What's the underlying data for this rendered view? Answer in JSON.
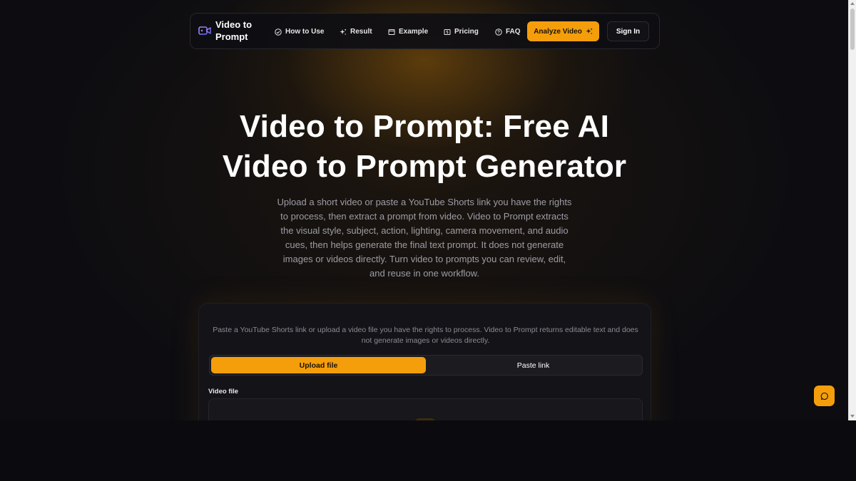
{
  "nav": {
    "brand": "Video to Prompt",
    "links": [
      {
        "label": "How to Use",
        "icon": "check-circle-icon"
      },
      {
        "label": "Result",
        "icon": "sparkle-icon"
      },
      {
        "label": "Example",
        "icon": "window-icon"
      },
      {
        "label": "Pricing",
        "icon": "dollar-box-icon"
      },
      {
        "label": "FAQ",
        "icon": "help-circle-icon"
      }
    ],
    "analyze_label": "Analyze Video",
    "signin_label": "Sign In"
  },
  "hero": {
    "title": "Video to Prompt: Free AI Video to Prompt Generator",
    "subtitle": "Upload a short video or paste a YouTube Shorts link you have the rights to process, then extract a prompt from video. Video to Prompt extracts the visual style, subject, action, lighting, camera movement, and audio cues, then helps generate the final text prompt. It does not generate images or videos directly. Turn video to prompts you can review, edit, and reuse in one workflow."
  },
  "card": {
    "description": "Paste a YouTube Shorts link or upload a video file you have the rights to process. Video to Prompt returns editable text and does not generate images or videos directly.",
    "tabs": [
      {
        "label": "Upload file",
        "active": true
      },
      {
        "label": "Paste link",
        "active": false
      }
    ],
    "field_label": "Video file"
  },
  "colors": {
    "accent": "#f59e0b",
    "background": "#0d0d11",
    "card": "#131318"
  }
}
